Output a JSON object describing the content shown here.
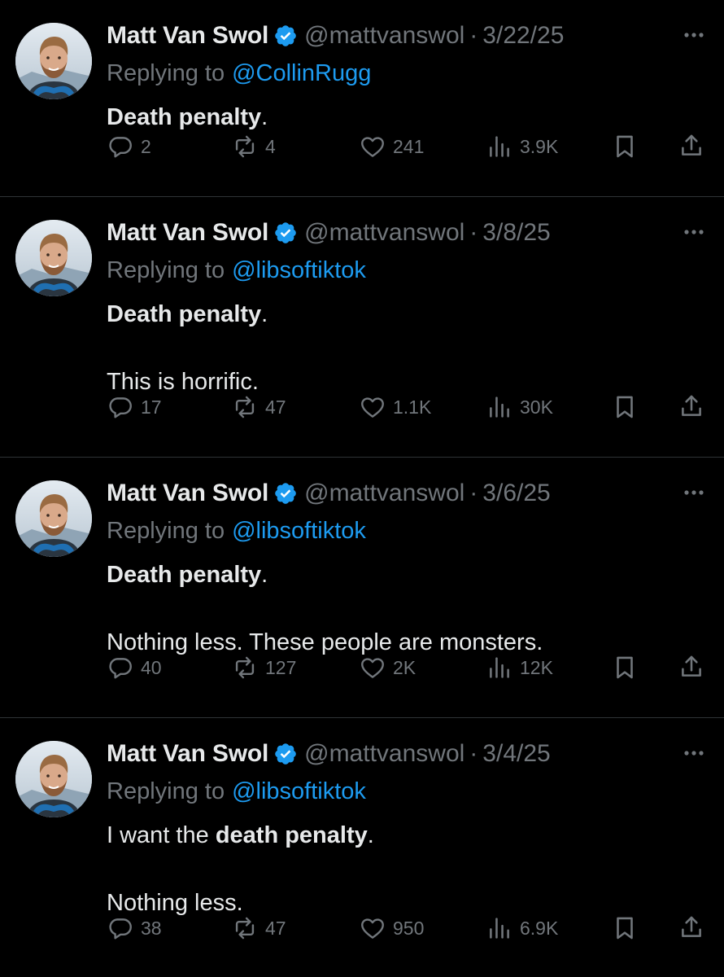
{
  "colors": {
    "background": "#000000",
    "text": "#e7e9ea",
    "muted": "#71767b",
    "link": "#1d9bf0",
    "verified_badge": "#1d9bf0",
    "separator": "#2f3336"
  },
  "tweets": [
    {
      "author": {
        "name": "Matt Van Swol",
        "handle": "@mattvanswol",
        "verified": true,
        "avatar": "avatar-photo"
      },
      "dot": "·",
      "date": "3/22/25",
      "replying_prefix": "Replying to",
      "replying_to": "@CollinRugg",
      "body": [
        [
          {
            "text": "Death penalty",
            "bold": true
          },
          {
            "text": "."
          }
        ]
      ],
      "stats": {
        "replies": "2",
        "reposts": "4",
        "likes": "241",
        "views": "3.9K"
      },
      "icons": {
        "more": "more-icon",
        "reply": "reply-icon",
        "repost": "repost-icon",
        "like": "like-icon",
        "views": "views-icon",
        "bookmark": "bookmark-icon",
        "share": "share-icon"
      }
    },
    {
      "author": {
        "name": "Matt Van Swol",
        "handle": "@mattvanswol",
        "verified": true,
        "avatar": "avatar-photo"
      },
      "dot": "·",
      "date": "3/8/25",
      "replying_prefix": "Replying to",
      "replying_to": "@libsoftiktok",
      "body": [
        [
          {
            "text": "Death penalty",
            "bold": true
          },
          {
            "text": "."
          }
        ],
        [
          {
            "text": "This is horrific."
          }
        ]
      ],
      "stats": {
        "replies": "17",
        "reposts": "47",
        "likes": "1.1K",
        "views": "30K"
      },
      "icons": {
        "more": "more-icon",
        "reply": "reply-icon",
        "repost": "repost-icon",
        "like": "like-icon",
        "views": "views-icon",
        "bookmark": "bookmark-icon",
        "share": "share-icon"
      }
    },
    {
      "author": {
        "name": "Matt Van Swol",
        "handle": "@mattvanswol",
        "verified": true,
        "avatar": "avatar-photo"
      },
      "dot": "·",
      "date": "3/6/25",
      "replying_prefix": "Replying to",
      "replying_to": "@libsoftiktok",
      "body": [
        [
          {
            "text": "Death penalty",
            "bold": true
          },
          {
            "text": "."
          }
        ],
        [
          {
            "text": "Nothing less. These people are monsters."
          }
        ]
      ],
      "stats": {
        "replies": "40",
        "reposts": "127",
        "likes": "2K",
        "views": "12K"
      },
      "icons": {
        "more": "more-icon",
        "reply": "reply-icon",
        "repost": "repost-icon",
        "like": "like-icon",
        "views": "views-icon",
        "bookmark": "bookmark-icon",
        "share": "share-icon"
      }
    },
    {
      "author": {
        "name": "Matt Van Swol",
        "handle": "@mattvanswol",
        "verified": true,
        "avatar": "avatar-photo"
      },
      "dot": "·",
      "date": "3/4/25",
      "replying_prefix": "Replying to",
      "replying_to": "@libsoftiktok",
      "body": [
        [
          {
            "text": "I want the "
          },
          {
            "text": "death penalty",
            "bold": true
          },
          {
            "text": "."
          }
        ],
        [
          {
            "text": "Nothing less."
          }
        ]
      ],
      "stats": {
        "replies": "38",
        "reposts": "47",
        "likes": "950",
        "views": "6.9K"
      },
      "icons": {
        "more": "more-icon",
        "reply": "reply-icon",
        "repost": "repost-icon",
        "like": "like-icon",
        "views": "views-icon",
        "bookmark": "bookmark-icon",
        "share": "share-icon"
      }
    }
  ]
}
